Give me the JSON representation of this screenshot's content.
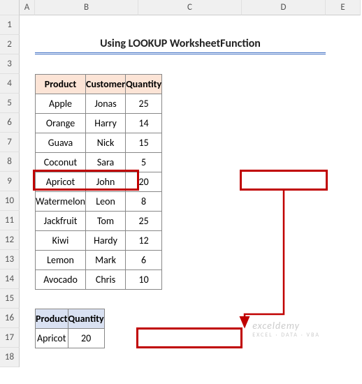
{
  "columns": [
    "A",
    "B",
    "C",
    "D",
    "E"
  ],
  "rows": [
    "1",
    "2",
    "3",
    "4",
    "5",
    "6",
    "7",
    "8",
    "9",
    "10",
    "11",
    "12",
    "13",
    "14",
    "15",
    "16",
    "17",
    "18"
  ],
  "title": "Using LOOKUP WorksheetFunction",
  "main": {
    "headers": {
      "product": "Product",
      "customer": "Customer",
      "quantity": "Quantity"
    },
    "data": [
      {
        "product": "Apple",
        "customer": "Jonas",
        "quantity": "25"
      },
      {
        "product": "Orange",
        "customer": "Harry",
        "quantity": "14"
      },
      {
        "product": "Guava",
        "customer": "Nick",
        "quantity": "15"
      },
      {
        "product": "Coconut",
        "customer": "Sara",
        "quantity": "5"
      },
      {
        "product": "Apricot",
        "customer": "John",
        "quantity": "20"
      },
      {
        "product": "Watermelon",
        "customer": "Leon",
        "quantity": "8"
      },
      {
        "product": "Jackfruit",
        "customer": "Tom",
        "quantity": "25"
      },
      {
        "product": "Kiwi",
        "customer": "Hardy",
        "quantity": "12"
      },
      {
        "product": "Lemon",
        "customer": "Mark",
        "quantity": "6"
      },
      {
        "product": "Avocado",
        "customer": "Chris",
        "quantity": "10"
      }
    ]
  },
  "lookup": {
    "headers": {
      "product": "Product",
      "quantity": "Quantity"
    },
    "data": {
      "product": "Apricot",
      "quantity": "20"
    }
  },
  "watermark": "exceldemy",
  "watermark_sub": "EXCEL · DATA · VBA"
}
